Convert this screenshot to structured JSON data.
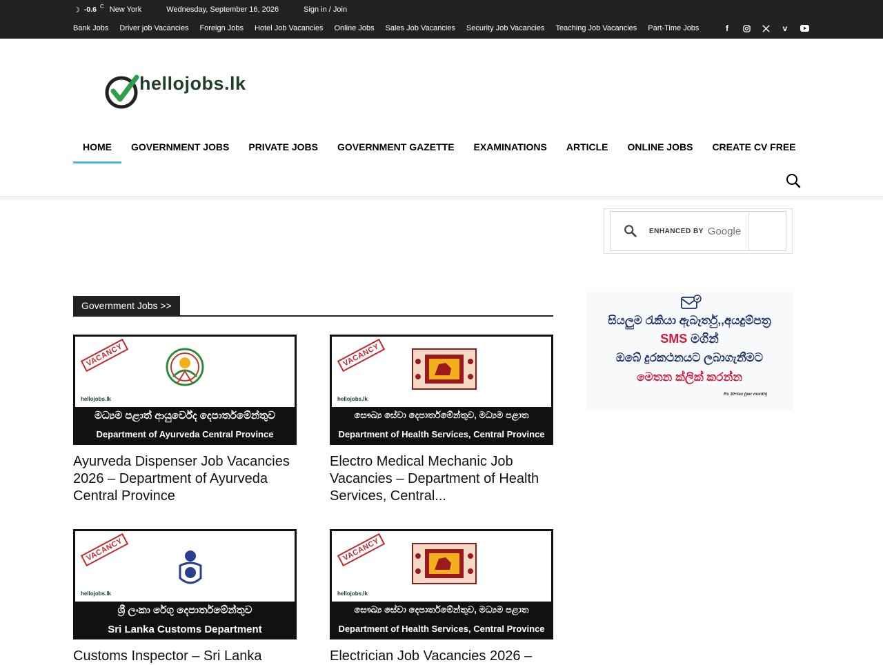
{
  "topbar": {
    "temperature": "-0.6",
    "temp_unit": "C",
    "city": "New York",
    "date": "Wednesday, September 16, 2026",
    "signin": "Sign in / Join",
    "links": [
      "Bank Jobs",
      "Driver job Vacancies",
      "Foreign Jobs",
      "Hotel Job Vacancies",
      "Online Jobs",
      "Sales Job Vacancies",
      "Security Job Vacancies",
      "Teaching Job Vacancies",
      "Part-Time Jobs"
    ],
    "social_icons": [
      "facebook-icon",
      "instagram-icon",
      "x-icon",
      "vimeo-icon",
      "youtube-icon"
    ]
  },
  "logo": {
    "text": "hellojobs.lk"
  },
  "nav": {
    "items": [
      "HOME",
      "GOVERNMENT JOBS",
      "PRIVATE JOBS",
      "GOVERNMENT GAZETTE",
      "EXAMINATIONS",
      "ARTICLE",
      "ONLINE JOBS",
      "CREATE CV FREE"
    ],
    "active": "HOME"
  },
  "search_widget": {
    "enhanced_by": "ENHANCED BY",
    "provider": "Google"
  },
  "sms_banner": {
    "line1": "සියලුම රැකියා ඇබෑර්තු,,අයදුම්පත්‍ර",
    "line2_highlight": "SMS",
    "line2_rest": " මගින්",
    "line3": "ඔබේ දුරකථනයට ලබාගැනීමට",
    "line4": "මෙතන ක්ලික් කරන්න",
    "price": "Rs 30+tax (per month)"
  },
  "section": {
    "title": "Government Jobs >>"
  },
  "cards": [
    {
      "stamp": "VACANCY",
      "mini_logo": "hellojobs.lk",
      "sinhala": "මධ්‍යම පළාත් ආයුර්වේද දෙපාර්තමේන්තුව",
      "english": "Department of Ayurveda Central Province",
      "title": "Ayurveda Dispenser Job Vacancies 2026 – Department of Ayurveda Central Province"
    },
    {
      "stamp": "VACANCY",
      "mini_logo": "hellojobs.lk",
      "sinhala": "සෞඛ්‍ය සේවා දෙපාර්තමේන්තුව, මධ්‍යම පළාත",
      "english": "Department of Health Services, Central Province",
      "title": "Electro Medical Mechanic Job Vacancies – Department of Health Services, Central..."
    },
    {
      "stamp": "VACANCY",
      "mini_logo": "hellojobs.lk",
      "sinhala": "ශ්‍රී ලංකා රේගු දෙපාර්තමේන්තුව",
      "english": "Sri Lanka Customs Department",
      "title": "Customs Inspector – Sri Lanka"
    },
    {
      "stamp": "VACANCY",
      "mini_logo": "hellojobs.lk",
      "sinhala": "සෞඛ්‍ය සේවා දෙපාර්තමේන්තුව, මධ්‍යම පළාත",
      "english": "Department of Health Services, Central Province",
      "title": "Electrician Job Vacancies 2026 –"
    }
  ]
}
